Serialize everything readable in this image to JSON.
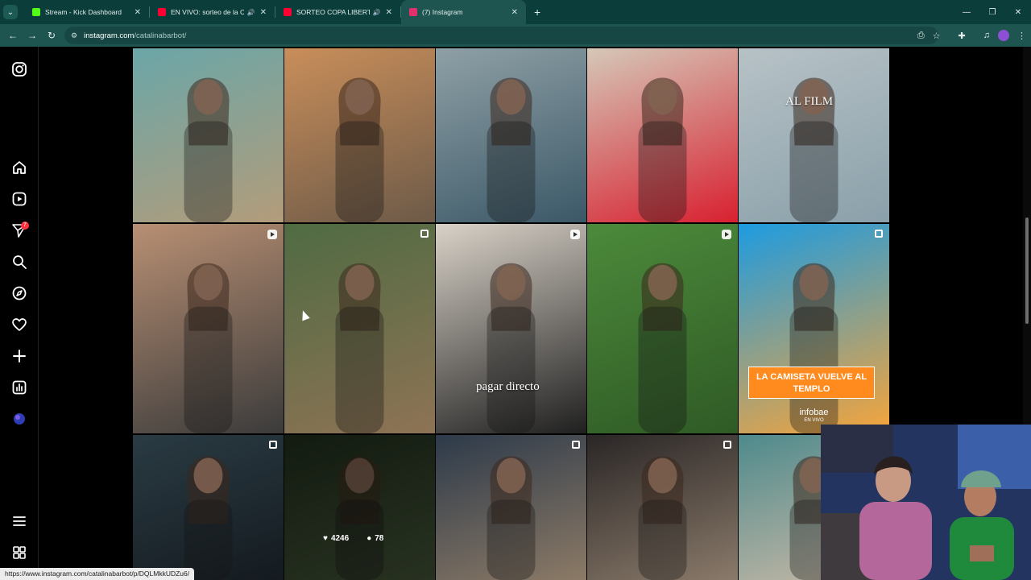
{
  "browser": {
    "tabs": [
      {
        "title": "Stream - Kick Dashboard",
        "favicon_color": "#53fc18",
        "audio": false,
        "active": false
      },
      {
        "title": "EN VIVO: sorteo de la Conm",
        "favicon_color": "#ff0033",
        "audio": true,
        "active": false
      },
      {
        "title": "SORTEO COPA LIBERTADOR",
        "favicon_color": "#ff0033",
        "audio": true,
        "active": false
      },
      {
        "title": "(7) Instagram",
        "favicon_color": "#e1306c",
        "audio": false,
        "active": true
      }
    ],
    "address": {
      "host": "instagram.com",
      "path": "/catalinabarbot/"
    },
    "status_url": "https://www.instagram.com/catalinabarbot/p/DQLMkkUDZu6/",
    "theme_colors": {
      "tabstrip": "#0b3d3a",
      "toolbar": "#1f5551"
    }
  },
  "sidebar": {
    "items": [
      {
        "name": "instagram-logo-icon",
        "glyph": "◎"
      },
      {
        "name": "home-icon",
        "glyph": "⌂"
      },
      {
        "name": "reels-icon",
        "glyph": "▶"
      },
      {
        "name": "messages-icon",
        "glyph": "➤"
      },
      {
        "name": "search-icon",
        "glyph": "⌕"
      },
      {
        "name": "explore-icon",
        "glyph": "◍"
      },
      {
        "name": "notifications-icon",
        "glyph": "♡"
      },
      {
        "name": "create-icon",
        "glyph": "+"
      },
      {
        "name": "dashboard-icon",
        "glyph": "▥"
      },
      {
        "name": "profile-icon",
        "glyph": "●"
      },
      {
        "name": "more-menu-icon",
        "glyph": "≡"
      },
      {
        "name": "also-from-meta-icon",
        "glyph": "⧉"
      }
    ],
    "messages_badge": "7"
  },
  "posts": {
    "row1": [
      {
        "kind": "photo",
        "colors": [
          "#6aa6a8",
          "#b39c7a"
        ]
      },
      {
        "kind": "photo",
        "colors": [
          "#c98e5a",
          "#6d5a48"
        ]
      },
      {
        "kind": "photo",
        "colors": [
          "#8fa0a6",
          "#3b5867"
        ]
      },
      {
        "kind": "photo",
        "colors": [
          "#d5c8b8",
          "#d82030"
        ]
      },
      {
        "kind": "photo",
        "colors": [
          "#b7c2c6",
          "#8aa0aa"
        ],
        "caption": "AL FILM"
      }
    ],
    "row2": [
      {
        "kind": "reel",
        "colors": [
          "#b88f73",
          "#3b3b3b"
        ]
      },
      {
        "kind": "multi",
        "colors": [
          "#4f6b42",
          "#8e7355"
        ]
      },
      {
        "kind": "reel",
        "colors": [
          "#d9d2c8",
          "#1f1f1f"
        ],
        "caption": "pagar directo"
      },
      {
        "kind": "reel",
        "colors": [
          "#4c8a3b",
          "#2f5a25"
        ]
      },
      {
        "kind": "multi",
        "colors": [
          "#1d9be0",
          "#f7a43a"
        ],
        "headline": "LA CAMISETA VUELVE AL TEMPLO",
        "brand": "infobae",
        "brand_sub": "EN VIVO"
      }
    ],
    "row3": [
      {
        "kind": "multi",
        "colors": [
          "#2a3b43",
          "#141a1f"
        ]
      },
      {
        "kind": "photo",
        "colors": [
          "#1d2a1a",
          "#3e4d33"
        ],
        "likes": "4246",
        "comments": "78"
      },
      {
        "kind": "multi",
        "colors": [
          "#2d3a4a",
          "#8c7a66"
        ]
      },
      {
        "kind": "multi",
        "colors": [
          "#2a2626",
          "#8a7a6a"
        ]
      },
      {
        "kind": "photo",
        "colors": [
          "#4e8a8c",
          "#cbbaa7"
        ]
      }
    ]
  }
}
